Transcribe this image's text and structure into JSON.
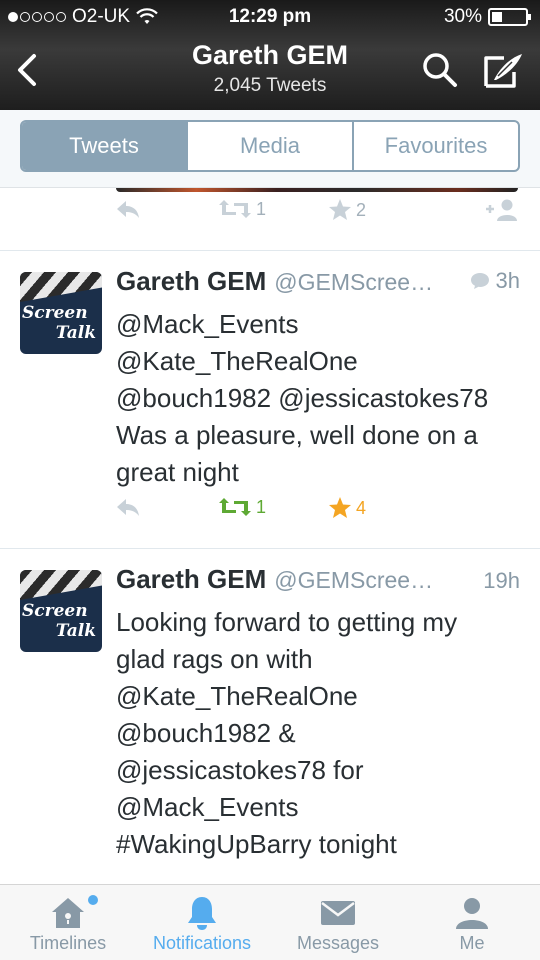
{
  "status_bar": {
    "carrier": "O2-UK",
    "time": "12:29 pm",
    "battery": "30%",
    "battery_level": 0.3,
    "signal_bars": 1
  },
  "header": {
    "title": "Gareth GEM",
    "subtitle": "2,045 Tweets",
    "icons": [
      "back-chevron-icon",
      "search-icon",
      "compose-icon"
    ]
  },
  "profile_tabs": {
    "items": [
      "Tweets",
      "Media",
      "Favourites"
    ],
    "selected": "Tweets"
  },
  "previous_tweet_actions": {
    "retweets": "1",
    "favourites": "2"
  },
  "tweets": [
    {
      "name": "Gareth GEM",
      "handle": "@GEMScree…",
      "time": "3h",
      "avatar_text_1": "Screen",
      "avatar_text_2": "Talk",
      "text_lines": [
        "@Mack_Events",
        "@Kate_TheRealOne",
        "@bouch1982 @jessicastokes78",
        "Was a pleasure, well done on a",
        "great night"
      ],
      "retweets": "1",
      "favourites": "4",
      "retweeted": true,
      "favorited": true
    },
    {
      "name": "Gareth GEM",
      "handle": "@GEMScree…",
      "time": "19h",
      "avatar_text_1": "Screen",
      "avatar_text_2": "Talk",
      "text_lines": [
        "Looking forward to getting my",
        "glad rags on with",
        "@Kate_TheRealOne",
        "@bouch1982 &",
        "@jessicastokes78 for",
        "@Mack_Events",
        "#WakingUpBarry tonight"
      ]
    }
  ],
  "tab_bar": {
    "items": [
      "Timelines",
      "Notifications",
      "Messages",
      "Me"
    ],
    "active": "Notifications"
  },
  "colors": {
    "accent": "#55acee",
    "retweet_green": "#5ea934",
    "favourite_orange": "#f4a523",
    "segment_blue": "#8aa3b5"
  }
}
